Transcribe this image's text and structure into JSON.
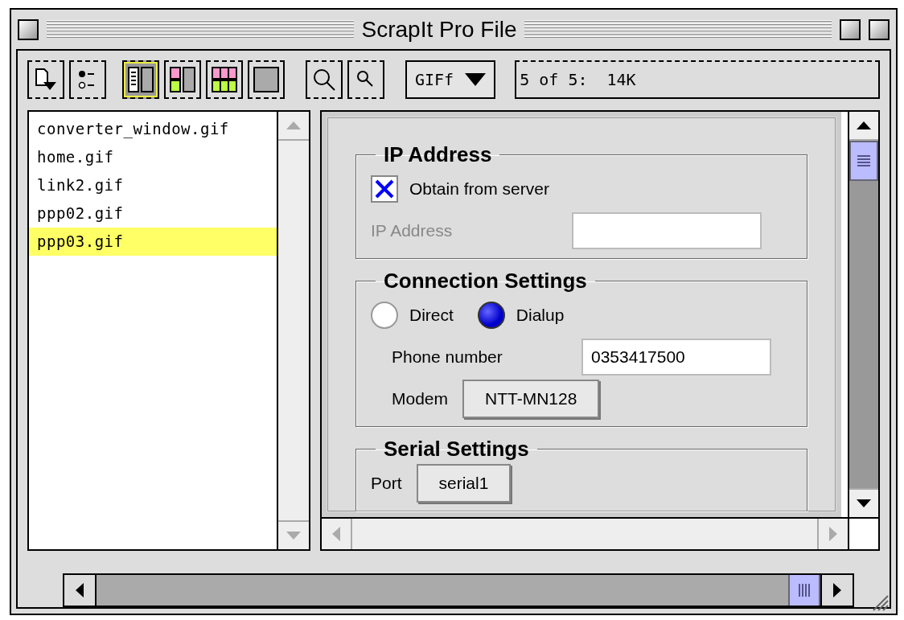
{
  "window": {
    "title": "ScrapIt Pro File"
  },
  "toolbar": {
    "view_buttons": [
      {
        "kind": "list",
        "selected": true
      },
      {
        "kind": "tile",
        "selected": false
      },
      {
        "kind": "grid",
        "selected": false
      },
      {
        "kind": "full",
        "selected": false
      }
    ],
    "format_menu": "GIFf",
    "status": "5 of 5:  14K"
  },
  "file_list": {
    "items": [
      {
        "name": "converter_window.gif",
        "selected": false
      },
      {
        "name": "home.gif",
        "selected": false
      },
      {
        "name": "link2.gif",
        "selected": false
      },
      {
        "name": "ppp02.gif",
        "selected": false
      },
      {
        "name": "ppp03.gif",
        "selected": true
      }
    ]
  },
  "preview": {
    "sections": [
      {
        "title": "IP Address",
        "rows": [
          {
            "kind": "checkbox",
            "label": "Obtain from server",
            "checked": true
          },
          {
            "kind": "field",
            "label": "IP Address",
            "disabled": true
          }
        ]
      },
      {
        "title": "Connection Settings",
        "rows": [
          {
            "kind": "radios",
            "options": [
              {
                "label": "Direct",
                "selected": false
              },
              {
                "label": "Dialup",
                "selected": true
              }
            ]
          },
          {
            "kind": "field",
            "label": "Phone number",
            "value": "0353417500",
            "disabled": false
          },
          {
            "kind": "button",
            "label": "Modem",
            "value": "NTT-MN128"
          }
        ]
      },
      {
        "title": "Serial Settings",
        "rows": [
          {
            "kind": "button",
            "label": "Port",
            "value": "serial1"
          }
        ]
      }
    ]
  }
}
